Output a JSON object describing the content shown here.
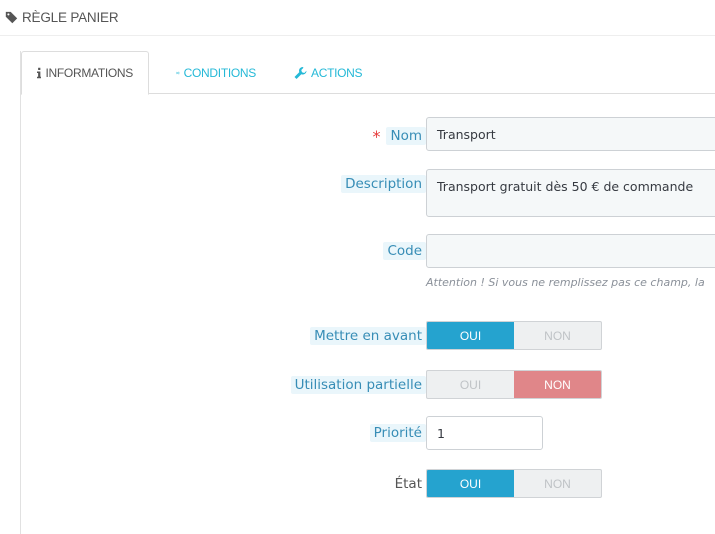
{
  "header": {
    "title": "RÈGLE PANIER",
    "icon": "tag-icon"
  },
  "tabs": [
    {
      "label": "INFORMATIONS",
      "icon": "info-icon",
      "active": true
    },
    {
      "label": "CONDITIONS",
      "icon": "shuffle-icon",
      "active": false
    },
    {
      "label": "ACTIONS",
      "icon": "wrench-icon",
      "active": false
    }
  ],
  "form": {
    "name": {
      "label": "Nom",
      "required_mark": "*",
      "value": "Transport"
    },
    "description": {
      "label": "Description",
      "value": "Transport gratuit dès 50 € de commande"
    },
    "code": {
      "label": "Code",
      "value": "",
      "help": "Attention ! Si vous ne remplissez pas ce champ, la"
    },
    "highlight": {
      "label": "Mettre en avant",
      "yes": "OUI",
      "no": "NON",
      "selected": "yes"
    },
    "partial_use": {
      "label": "Utilisation partielle",
      "yes": "OUI",
      "no": "NON",
      "selected": "no"
    },
    "priority": {
      "label": "Priorité",
      "value": "1"
    },
    "status": {
      "label": "État",
      "yes": "OUI",
      "no": "NON",
      "selected": "yes"
    }
  },
  "colors": {
    "accent": "#25a3cf",
    "danger": "#e08689",
    "link": "#25b9d7"
  }
}
